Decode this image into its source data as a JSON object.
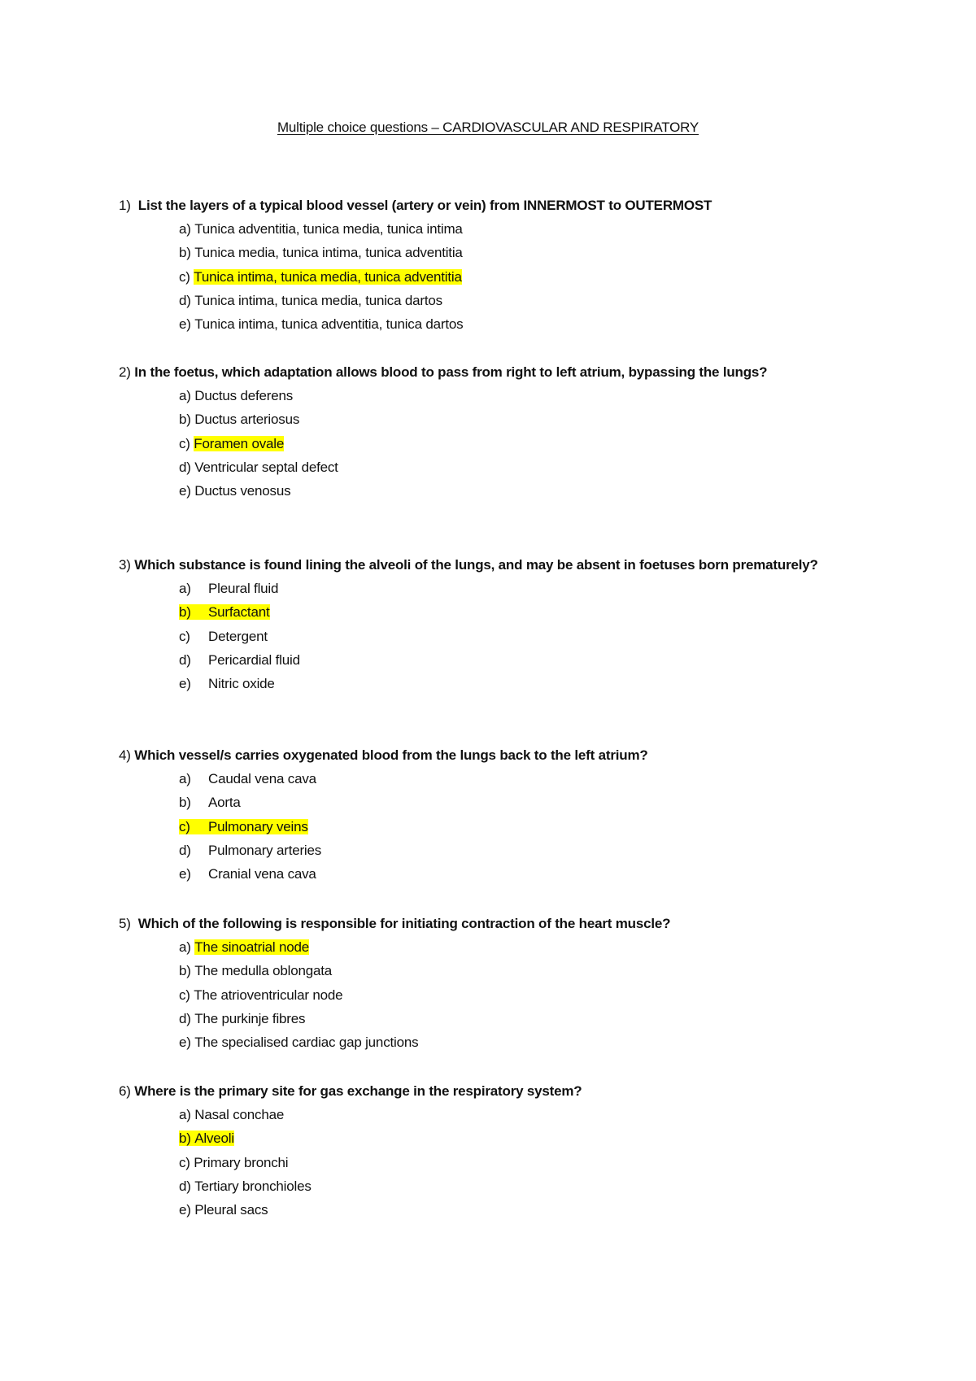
{
  "document": {
    "title": "Multiple choice questions – CARDIOVASCULAR AND RESPIRATORY",
    "highlight_color": "#ffff00"
  },
  "questions": [
    {
      "number": "1)",
      "text": "List the layers of a typical blood vessel (artery or vein) from INNERMOST to OUTERMOST",
      "options": [
        {
          "letter": "a)",
          "text": "Tunica adventitia, tunica media, tunica intima",
          "correct": false
        },
        {
          "letter": "b)",
          "text": "Tunica media, tunica intima, tunica adventitia",
          "correct": false
        },
        {
          "letter": "c)",
          "text": "Tunica intima, tunica media, tunica adventitia",
          "correct": true
        },
        {
          "letter": "d)",
          "text": "Tunica intima, tunica media, tunica dartos",
          "correct": false
        },
        {
          "letter": "e)",
          "text": "Tunica intima, tunica adventitia, tunica dartos",
          "correct": false
        }
      ]
    },
    {
      "number": "2)",
      "text": "In the foetus, which adaptation allows blood to pass from right to left atrium, bypassing the lungs?",
      "options": [
        {
          "letter": "a)",
          "text": "Ductus deferens",
          "correct": false
        },
        {
          "letter": "b)",
          "text": "Ductus arteriosus",
          "correct": false
        },
        {
          "letter": "c)",
          "text": "Foramen ovale",
          "correct": true
        },
        {
          "letter": "d)",
          "text": "Ventricular septal defect",
          "correct": false
        },
        {
          "letter": "e)",
          "text": "Ductus venosus",
          "correct": false
        }
      ]
    },
    {
      "number": "3)",
      "text": "Which substance is found lining the alveoli of the lungs, and may be absent in foetuses born prematurely?",
      "options": [
        {
          "letter": "a)",
          "text": "Pleural fluid",
          "correct": false
        },
        {
          "letter": "b)",
          "text": "Surfactant",
          "correct": true
        },
        {
          "letter": "c)",
          "text": "Detergent",
          "correct": false
        },
        {
          "letter": "d)",
          "text": "Pericardial fluid",
          "correct": false
        },
        {
          "letter": "e)",
          "text": "Nitric oxide",
          "correct": false
        }
      ]
    },
    {
      "number": "4)",
      "text": "Which vessel/s carries oxygenated blood from the lungs back to the left atrium?",
      "options": [
        {
          "letter": "a)",
          "text": "Caudal vena cava",
          "correct": false
        },
        {
          "letter": "b)",
          "text": "Aorta",
          "correct": false
        },
        {
          "letter": "c)",
          "text": "Pulmonary veins",
          "correct": true
        },
        {
          "letter": "d)",
          "text": "Pulmonary arteries",
          "correct": false
        },
        {
          "letter": "e)",
          "text": "Cranial vena cava",
          "correct": false
        }
      ]
    },
    {
      "number": "5)",
      "text": "Which of the following is responsible for initiating contraction of the heart muscle?",
      "options": [
        {
          "letter": "a)",
          "text": "The sinoatrial node",
          "correct": true
        },
        {
          "letter": "b)",
          "text": "The medulla oblongata",
          "correct": false
        },
        {
          "letter": "c)",
          "text": "The atrioventricular node",
          "correct": false
        },
        {
          "letter": "d)",
          "text": "The purkinje fibres",
          "correct": false
        },
        {
          "letter": "e)",
          "text": "The specialised cardiac gap junctions",
          "correct": false
        }
      ]
    },
    {
      "number": "6)",
      "text": "Where is the primary site for gas exchange in the respiratory system?",
      "options": [
        {
          "letter": "a)",
          "text": "Nasal conchae",
          "correct": false
        },
        {
          "letter": "b)",
          "text": "Alveoli",
          "correct": true
        },
        {
          "letter": "c)",
          "text": "Primary bronchi",
          "correct": false
        },
        {
          "letter": "d)",
          "text": "Tertiary bronchioles",
          "correct": false
        },
        {
          "letter": "e)",
          "text": "Pleural sacs",
          "correct": false
        }
      ]
    }
  ]
}
